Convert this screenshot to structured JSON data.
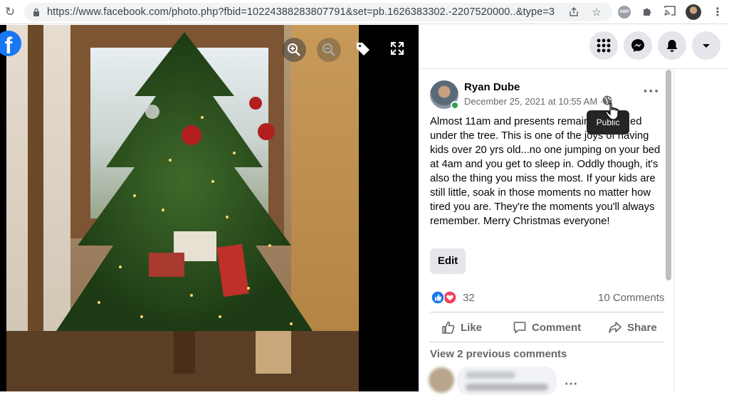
{
  "browser": {
    "url": "https://www.facebook.com/photo.php?fbid=10224388283807791&set=pb.1626383302.-2207520000..&type=3",
    "abp_label": "ABP"
  },
  "photo_viewer": {
    "logo": "f",
    "controls": [
      "zoom-in",
      "zoom-out",
      "tag",
      "fullscreen"
    ]
  },
  "post": {
    "author": "Ryan Dube",
    "date": "December 25, 2021 at 10:55 AM ·",
    "privacy_tooltip": "Public",
    "text": "Almost 11am and presents remain untouched under the tree. This is one of the joys of having kids over 20 yrs old...no one jumping on your bed at 4am and you get to sleep in. Oddly though, it's also the thing you miss the most. If your kids are still little, soak in those moments no matter how tired you are. They're the moments you'll always remember. Merry Christmas everyone!",
    "edit_label": "Edit",
    "reaction_count": "32",
    "comments_count": "10 Comments",
    "actions": {
      "like": "Like",
      "comment": "Comment",
      "share": "Share"
    },
    "view_previous": "View 2 previous comments"
  },
  "colors": {
    "facebook_blue": "#1877f2",
    "like_blue": "#1877f2",
    "love_red": "#f33e58",
    "online_green": "#31a24c",
    "secondary_text": "#65676b"
  }
}
